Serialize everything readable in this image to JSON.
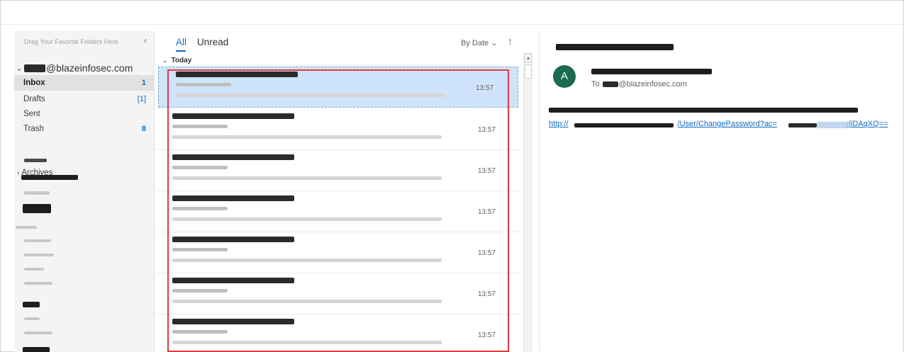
{
  "folder_pane": {
    "drag_hint": "Drag Your Favorite Folders Here",
    "collapse_glyph": "‹",
    "account_domain": "@blazeinfosec.com",
    "folders": [
      {
        "label": "Inbox",
        "count": "1"
      },
      {
        "label": "Drafts",
        "count": "[1]"
      },
      {
        "label": "Sent",
        "count": ""
      },
      {
        "label": "Trash",
        "count": "8"
      }
    ],
    "archives_label": "Archives"
  },
  "message_list": {
    "tabs": {
      "all": "All",
      "unread": "Unread"
    },
    "sort_label": "By Date",
    "sort_direction_glyph": "↑",
    "group_header": "Today",
    "messages": [
      {
        "time": "13:57"
      },
      {
        "time": "13:57"
      },
      {
        "time": "13:57"
      },
      {
        "time": "13:57"
      },
      {
        "time": "13:57"
      },
      {
        "time": "13:57"
      },
      {
        "time": "13:57"
      }
    ]
  },
  "reading_pane": {
    "avatar_initial": "A",
    "to_label": "To",
    "to_domain": "@blazeinfosec.com",
    "link_start": "http://",
    "link_mid": "/User/ChangePassword?ac=",
    "link_end": "diDAqXQ=="
  },
  "colors": {
    "accent": "#0f6cbd",
    "avatar_bg": "#1b6b52",
    "highlight_border": "#e03a3e",
    "selected_row": "#cfe4fa"
  }
}
